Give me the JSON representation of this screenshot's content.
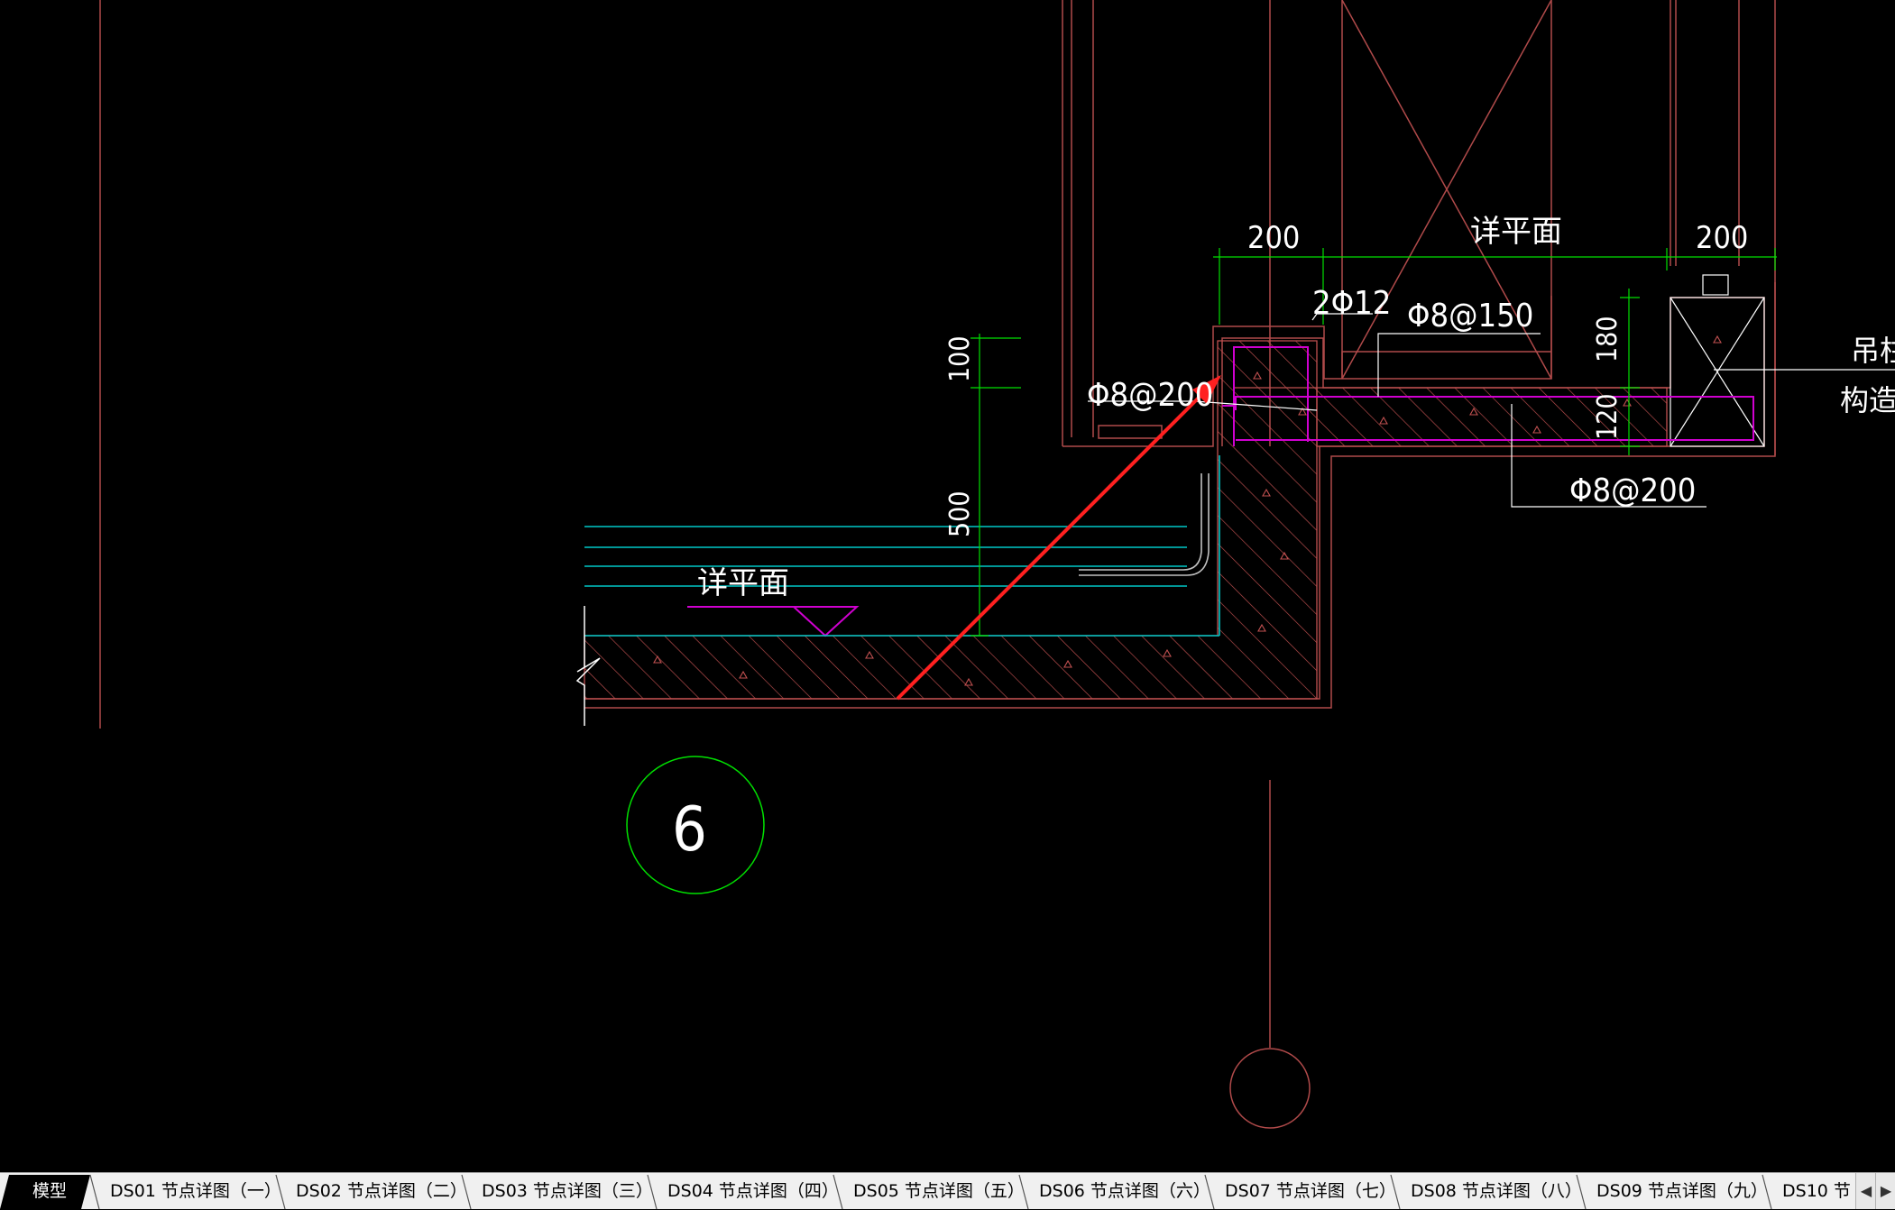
{
  "drawing": {
    "dims": {
      "d200_left": "200",
      "d200_right": "200",
      "d100": "100",
      "d500": "500",
      "d180": "180",
      "d120": "120"
    },
    "labels": {
      "plan_ref_top": "详平面",
      "plan_ref_left": "详平面",
      "rebar_2phi12": "2Φ12",
      "rebar_phi8_150": "Φ8@150",
      "rebar_phi8_200_left": "Φ8@200",
      "rebar_phi8_200_bottom": "Φ8@200",
      "note_column": "吊柱下",
      "note_detail": "构造详"
    },
    "detail_number": "6"
  },
  "colors": {
    "background": "#000000",
    "dimension": "#00e000",
    "outline": "#b04a4a",
    "hatch": "#c05050",
    "rebar": "#d000d0",
    "water": "#00c8c8",
    "arrow": "#ff2020",
    "text": "#ffffff"
  },
  "tabs": [
    {
      "label": "模型",
      "active": true
    },
    {
      "label": "DS01 节点详图（一）",
      "active": false
    },
    {
      "label": "DS02 节点详图（二）",
      "active": false
    },
    {
      "label": "DS03 节点详图（三）",
      "active": false
    },
    {
      "label": "DS04 节点详图（四）",
      "active": false
    },
    {
      "label": "DS05 节点详图（五）",
      "active": false
    },
    {
      "label": "DS06 节点详图（六）",
      "active": false
    },
    {
      "label": "DS07 节点详图（七）",
      "active": false
    },
    {
      "label": "DS08 节点详图（八）",
      "active": false
    },
    {
      "label": "DS09 节点详图（九）",
      "active": false
    },
    {
      "label": "DS10 节",
      "active": false
    }
  ],
  "tab_scroll": {
    "left_icon": "chevron-left-icon",
    "right_icon": "chevron-right-icon"
  }
}
